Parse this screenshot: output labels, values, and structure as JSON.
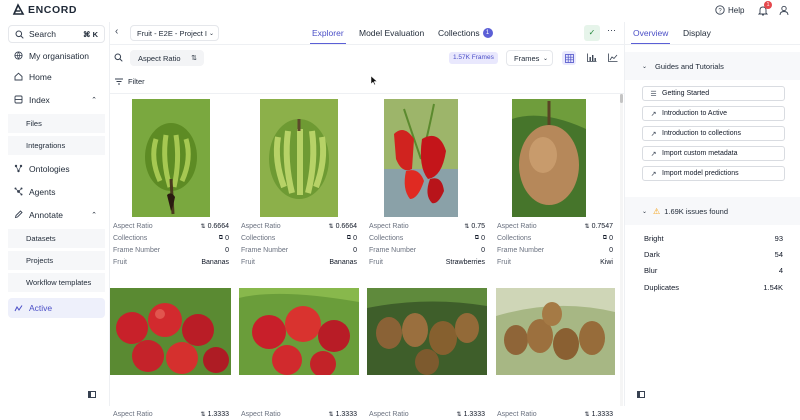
{
  "brand": {
    "logo_text": "ENCORD"
  },
  "top": {
    "help_label": "Help",
    "notification_count": "1"
  },
  "sidebar": {
    "search_label": "Search",
    "search_shortcut": "⌘ K",
    "org_label": "My organisation",
    "items": [
      {
        "label": "Home",
        "icon": "home-icon"
      },
      {
        "label": "Index",
        "icon": "index-icon"
      },
      {
        "label": "Files"
      },
      {
        "label": "Integrations"
      },
      {
        "label": "Ontologies",
        "icon": "ontology-icon"
      },
      {
        "label": "Agents",
        "icon": "agents-icon"
      },
      {
        "label": "Annotate",
        "icon": "annotate-icon"
      },
      {
        "label": "Datasets"
      },
      {
        "label": "Projects"
      },
      {
        "label": "Workflow templates"
      },
      {
        "label": "Active",
        "icon": "active-icon"
      }
    ]
  },
  "project": {
    "name": "Fruit - E2E - Project I"
  },
  "tabs": {
    "explorer": "Explorer",
    "model_evaluation": "Model Evaluation",
    "collections": "Collections",
    "collections_count": "1"
  },
  "toolbar": {
    "sort_label": "Aspect Ratio",
    "frames_badge": "1.57K Frames",
    "frames_select": "Frames",
    "filter_label": "Filter"
  },
  "grid": {
    "labels": {
      "aspect_ratio": "Aspect Ratio",
      "collections": "Collections",
      "frame_number": "Frame Number",
      "fruit": "Fruit"
    },
    "cards": [
      {
        "aspect_ratio": "0.6664",
        "collections": "0",
        "frame_number": "0",
        "fruit": "Bananas"
      },
      {
        "aspect_ratio": "0.6664",
        "collections": "0",
        "frame_number": "0",
        "fruit": "Bananas"
      },
      {
        "aspect_ratio": "0.75",
        "collections": "0",
        "frame_number": "0",
        "fruit": "Strawberries"
      },
      {
        "aspect_ratio": "0.7547",
        "collections": "0",
        "frame_number": "0",
        "fruit": "Kiwi"
      },
      {
        "aspect_ratio": "1.3333"
      },
      {
        "aspect_ratio": "1.3333"
      },
      {
        "aspect_ratio": "1.3333"
      },
      {
        "aspect_ratio": "1.3333"
      }
    ]
  },
  "right_panel": {
    "tabs": {
      "overview": "Overview",
      "display": "Display"
    },
    "guides_title": "Guides and Tutorials",
    "guides": [
      {
        "label": "Getting Started",
        "icon": "list-icon"
      },
      {
        "label": "Introduction to Active",
        "icon": "external-link-icon"
      },
      {
        "label": "Introduction to collections",
        "icon": "external-link-icon"
      },
      {
        "label": "Import custom metadata",
        "icon": "external-link-icon"
      },
      {
        "label": "Import model predictions",
        "icon": "external-link-icon"
      }
    ],
    "issues_title": "1.69K issues found",
    "issues": [
      {
        "label": "Bright",
        "value": "93"
      },
      {
        "label": "Dark",
        "value": "54"
      },
      {
        "label": "Blur",
        "value": "4"
      },
      {
        "label": "Duplicates",
        "value": "1.54K"
      }
    ]
  },
  "colors": {
    "accent": "#5b5fd6",
    "badge_bg": "#e9e8fd",
    "warning": "#f59e0b"
  }
}
